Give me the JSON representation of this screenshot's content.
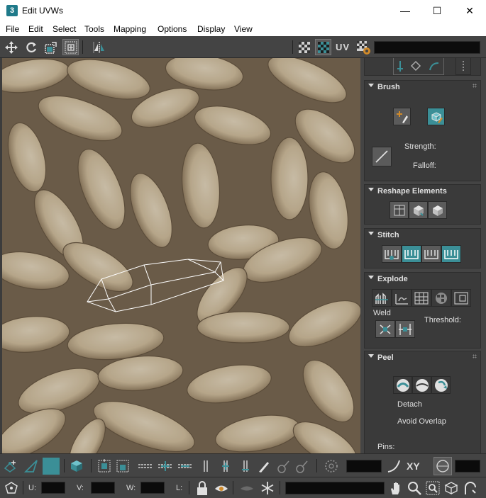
{
  "window": {
    "title": "Edit UVWs",
    "app_icon_glyph": "3",
    "minimize": "—",
    "maximize": "☐",
    "close": "✕"
  },
  "menu": {
    "items": [
      "File",
      "Edit",
      "Select",
      "Tools",
      "Mapping",
      "Options",
      "Display",
      "View"
    ]
  },
  "toolbar_top": {
    "uv_label": "UV",
    "combo_value": ""
  },
  "panel": {
    "brush": {
      "title": "Brush",
      "strength_label": "Strength:",
      "falloff_label": "Falloff:"
    },
    "reshape": {
      "title": "Reshape Elements"
    },
    "stitch": {
      "title": "Stitch"
    },
    "explode": {
      "title": "Explode",
      "weld_label": "Weld",
      "threshold_label": "Threshold:"
    },
    "peel": {
      "title": "Peel",
      "detach_label": "Detach",
      "avoid_overlap_label": "Avoid Overlap",
      "pins_label": "Pins:"
    }
  },
  "bottom": {
    "u_label": "U:",
    "v_label": "V:",
    "w_label": "W:",
    "l_label": "L:",
    "xy_label": "XY",
    "u_value": "",
    "v_value": "",
    "w_value": "",
    "l_value": ""
  },
  "colors": {
    "accent_teal": "#3b8f97",
    "panel_bg": "#444444",
    "rollout_bg": "#3a3a3a",
    "field_bg": "#0b0b0b",
    "texture_base": "#bfa98a"
  }
}
